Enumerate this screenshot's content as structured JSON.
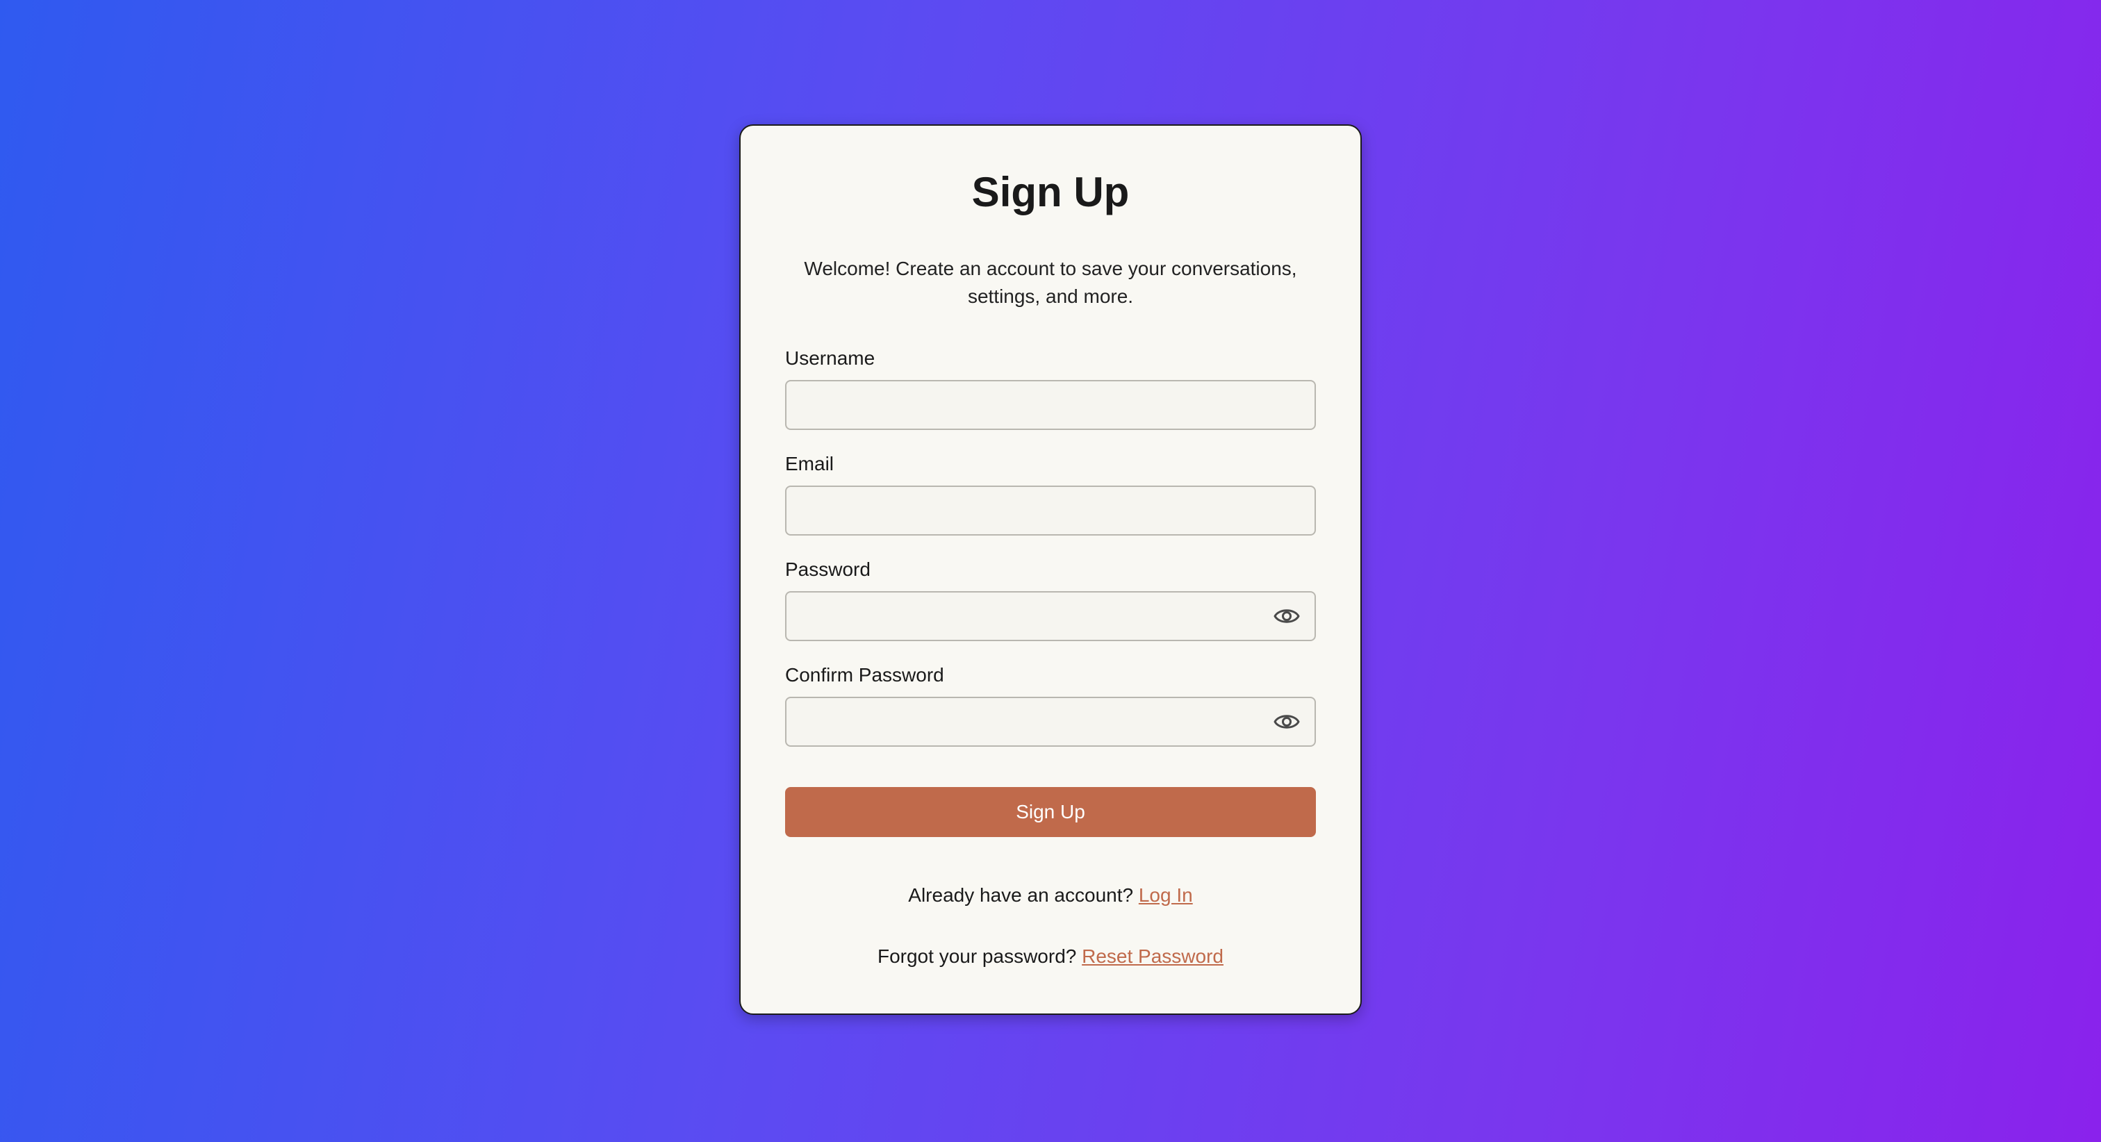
{
  "colors": {
    "background_start": "#2f5af0",
    "background_end": "#8a22ec",
    "card": "#f9f8f3",
    "accent": "#c06a4b"
  },
  "signup": {
    "title": "Sign Up",
    "subtitle": "Welcome! Create an account to save your conversations, settings, and more.",
    "fields": {
      "username": {
        "label": "Username",
        "value": "",
        "placeholder": ""
      },
      "email": {
        "label": "Email",
        "value": "",
        "placeholder": ""
      },
      "password": {
        "label": "Password",
        "value": "",
        "placeholder": "",
        "icon": "eye-icon"
      },
      "confirm_password": {
        "label": "Confirm Password",
        "value": "",
        "placeholder": "",
        "icon": "eye-icon"
      }
    },
    "submit_label": "Sign Up",
    "login_prompt": "Already have an account?",
    "login_link": "Log In",
    "reset_prompt": "Forgot your password?",
    "reset_link": "Reset Password"
  }
}
